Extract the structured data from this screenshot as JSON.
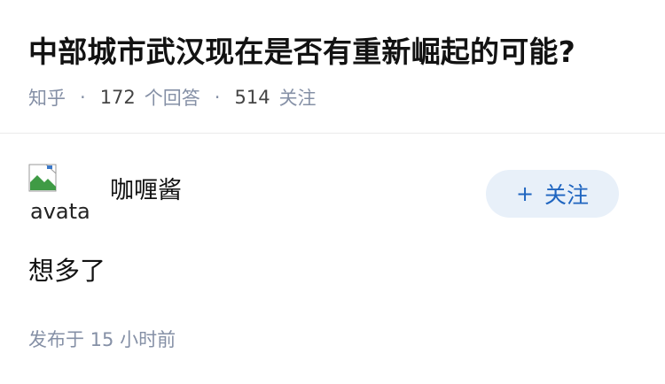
{
  "question": {
    "title": "中部城市武汉现在是否有重新崛起的可能?",
    "source": "知乎",
    "separator": "·",
    "answer_count": "172",
    "answer_count_label": "个回答",
    "follower_count": "514",
    "follower_count_label": "关注"
  },
  "answer": {
    "author": {
      "name": "咖喱酱",
      "avatar_alt": "avatar",
      "avatar_icon": "broken-image-icon"
    },
    "follow_button": {
      "icon": "+",
      "label": "关注"
    },
    "content": "想多了",
    "published": "发布于 15 小时前"
  },
  "colors": {
    "text": "#121212",
    "meta": "#8590a6",
    "follow_bg": "#e8f0f9",
    "follow_text": "#1f65c0",
    "divider": "#ebebeb"
  }
}
